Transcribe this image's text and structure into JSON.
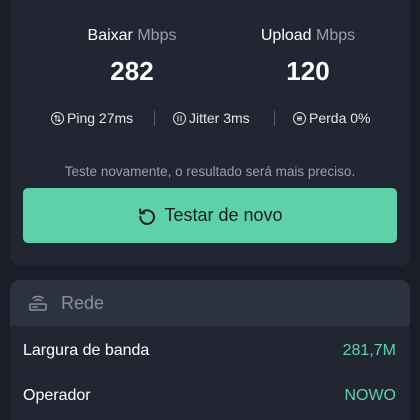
{
  "results": {
    "download": {
      "label": "Baixar",
      "unit": "Mbps",
      "value": "282"
    },
    "upload": {
      "label": "Upload",
      "unit": "Mbps",
      "value": "120"
    },
    "ping": {
      "icon": "ping-icon",
      "text": "Ping 27ms"
    },
    "jitter": {
      "icon": "jitter-icon",
      "text": "Jitter 3ms"
    },
    "loss": {
      "icon": "packet-loss-icon",
      "text": "Perda 0%"
    },
    "hint": "Teste novamente, o resultado será mais preciso.",
    "retest_button": {
      "icon": "restart-icon",
      "label": "Testar de novo"
    }
  },
  "network": {
    "icon": "router-icon",
    "title": "Rede",
    "rows": [
      {
        "label": "Largura de banda",
        "value": "281,7M"
      },
      {
        "label": "Operador",
        "value": "NOWO"
      }
    ]
  },
  "colors": {
    "background": "#1b1e28",
    "card": "#222633",
    "accent": "#5ed1a8",
    "muted_text": "#9a9fab"
  }
}
